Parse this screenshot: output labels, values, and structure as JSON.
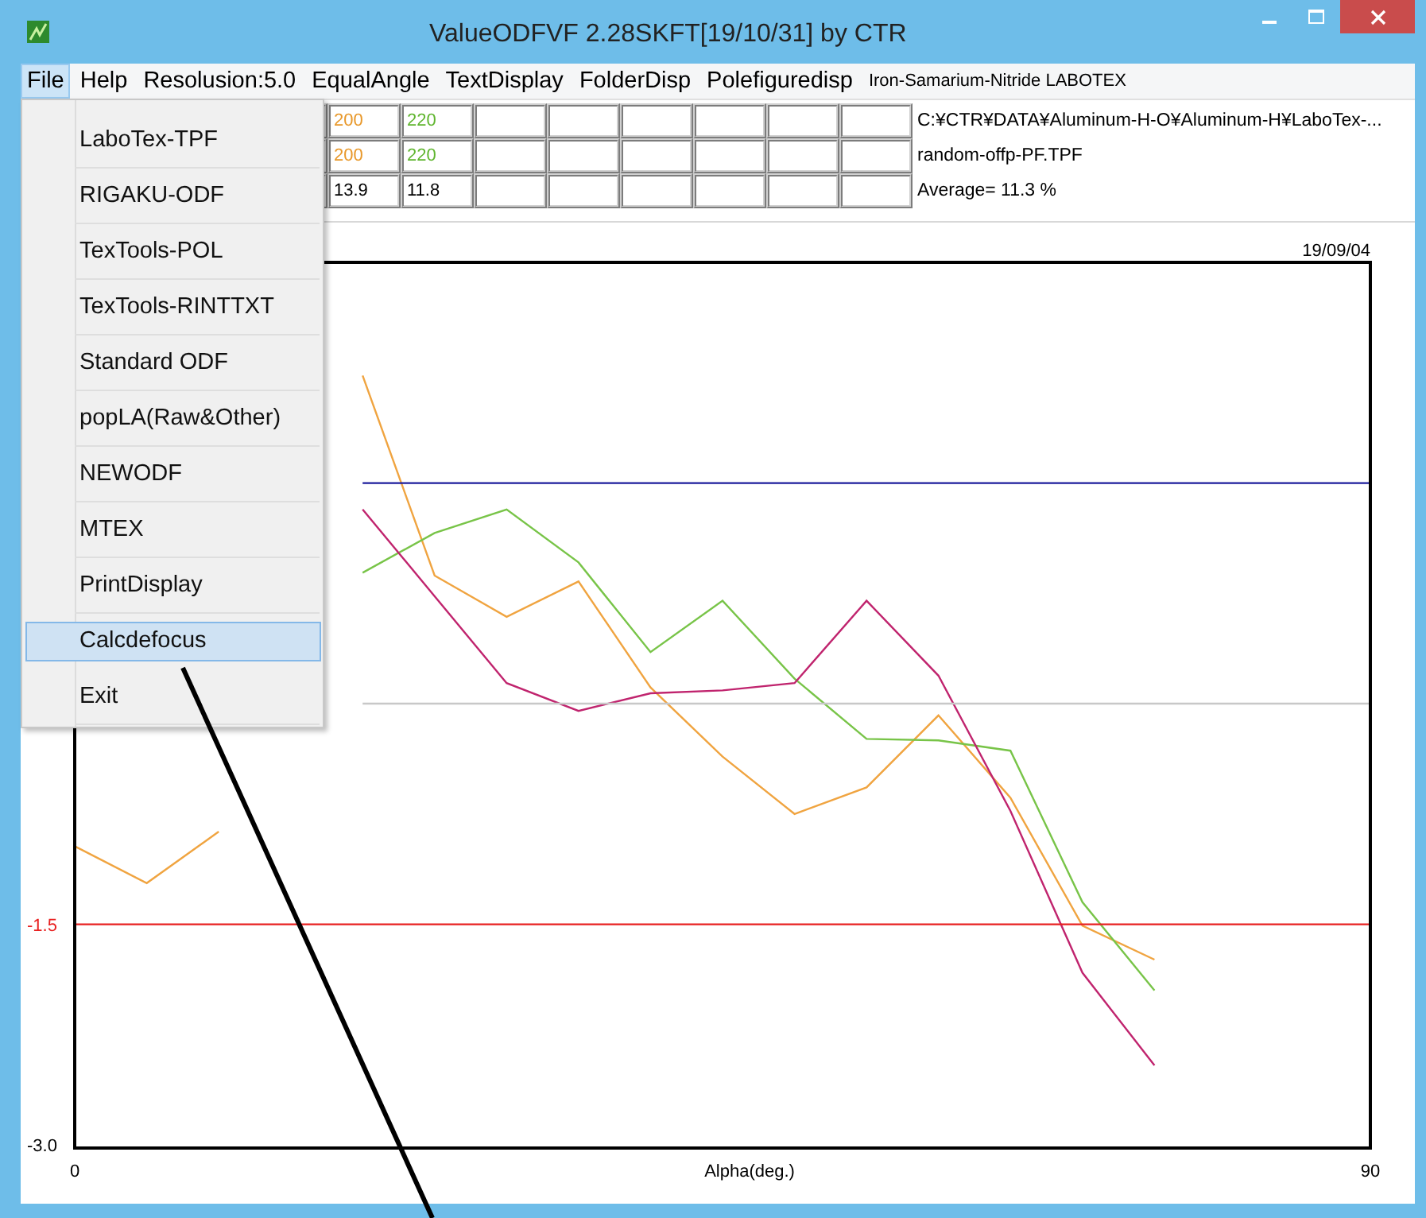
{
  "window": {
    "title": "ValueODFVF 2.28SKFT[19/10/31] by CTR"
  },
  "menu_bar": [
    {
      "label": "File",
      "selected": true,
      "kind": "menu"
    },
    {
      "label": "Help",
      "selected": false,
      "kind": "menu"
    },
    {
      "label": "Resolusion:5.0",
      "selected": false,
      "kind": "menu"
    },
    {
      "label": "EqualAngle",
      "selected": false,
      "kind": "menu"
    },
    {
      "label": "TextDisplay",
      "selected": false,
      "kind": "menu"
    },
    {
      "label": "FolderDisp",
      "selected": false,
      "kind": "menu"
    },
    {
      "label": "Polefiguredisp",
      "selected": false,
      "kind": "menu"
    },
    {
      "label": "Iron-Samarium-Nitride LABOTEX",
      "selected": false,
      "kind": "label"
    }
  ],
  "grid": {
    "rows": [
      {
        "cells": [
          {
            "text": "200",
            "color": "#e8982a"
          },
          {
            "text": "220",
            "color": "#5fb52e"
          },
          {
            "text": ""
          },
          {
            "text": ""
          },
          {
            "text": ""
          },
          {
            "text": ""
          },
          {
            "text": ""
          },
          {
            "text": ""
          }
        ],
        "info": "C:¥CTR¥DATA¥Aluminum-H-O¥Aluminum-H¥LaboTex-..."
      },
      {
        "cells": [
          {
            "text": "200",
            "color": "#e8982a"
          },
          {
            "text": "220",
            "color": "#5fb52e"
          },
          {
            "text": ""
          },
          {
            "text": ""
          },
          {
            "text": ""
          },
          {
            "text": ""
          },
          {
            "text": ""
          },
          {
            "text": ""
          }
        ],
        "info": "random-offp-PF.TPF"
      },
      {
        "cells": [
          {
            "text": "13.9",
            "color": "#000000"
          },
          {
            "text": "11.8",
            "color": "#000000"
          },
          {
            "text": ""
          },
          {
            "text": ""
          },
          {
            "text": ""
          },
          {
            "text": ""
          },
          {
            "text": ""
          },
          {
            "text": ""
          }
        ],
        "info": "Average= 11.3 %"
      }
    ]
  },
  "date": "19/09/04",
  "chart_data": {
    "type": "line",
    "xlabel": "Alpha(deg.)",
    "x": [
      0,
      5,
      10,
      15,
      20,
      25,
      30,
      35,
      40,
      45,
      50,
      55,
      60,
      65,
      70,
      75,
      80,
      85,
      90
    ],
    "xlim": [
      0,
      90
    ],
    "ylim": [
      -3,
      3
    ],
    "xticks": [
      0,
      90
    ],
    "yticks": [
      {
        "value": -1.5,
        "label": "-1.5"
      },
      {
        "value": -3,
        "label": "-3.0"
      }
    ],
    "series": [
      {
        "color": "#f0a440",
        "values": [
          -0.97,
          -1.22,
          -0.87,
          null,
          2.23,
          0.87,
          0.59,
          0.83,
          0.11,
          -0.36,
          -0.75,
          -0.57,
          -0.08,
          -0.64,
          -1.51,
          -1.74,
          null,
          null,
          null
        ]
      },
      {
        "color": "#78c448",
        "values": [
          null,
          null,
          null,
          null,
          0.89,
          1.16,
          1.32,
          0.96,
          0.35,
          0.7,
          0.17,
          -0.24,
          -0.25,
          -0.32,
          -1.35,
          -1.95,
          null,
          null,
          null
        ]
      },
      {
        "color": "#c0246e",
        "values": [
          null,
          null,
          null,
          null,
          1.32,
          0.73,
          0.14,
          -0.05,
          0.07,
          0.09,
          0.14,
          0.7,
          0.19,
          -0.73,
          -1.83,
          -2.46,
          null,
          null,
          null
        ]
      },
      {
        "color": "#1c1c9c",
        "values": [
          null,
          null,
          null,
          null,
          1.5,
          1.5,
          1.5,
          1.5,
          1.5,
          1.5,
          1.5,
          1.5,
          1.5,
          1.5,
          1.5,
          1.5,
          1.5,
          1.5,
          1.5
        ]
      },
      {
        "color": "#c8c8c8",
        "values": [
          null,
          null,
          null,
          null,
          0,
          0,
          0,
          0,
          0,
          0,
          0,
          0,
          0,
          0,
          0,
          0,
          0,
          0,
          0
        ]
      },
      {
        "color": "#e82020",
        "values": [
          -1.5,
          -1.5,
          -1.5,
          -1.5,
          -1.5,
          -1.5,
          -1.5,
          -1.5,
          -1.5,
          -1.5,
          -1.5,
          -1.5,
          -1.5,
          -1.5,
          -1.5,
          -1.5,
          -1.5,
          -1.5,
          -1.5
        ]
      }
    ]
  },
  "open_menu": {
    "items": [
      {
        "label": "LaboTex-TPF",
        "selected": false
      },
      {
        "label": "RIGAKU-ODF",
        "selected": false
      },
      {
        "label": "TexTools-POL",
        "selected": false
      },
      {
        "label": "TexTools-RINTTXT",
        "selected": false
      },
      {
        "label": "Standard ODF",
        "selected": false
      },
      {
        "label": "popLA(Raw&Other)",
        "selected": false
      },
      {
        "label": "NEWODF",
        "selected": false
      },
      {
        "label": "MTEX",
        "selected": false
      },
      {
        "label": "PrintDisplay",
        "selected": false
      },
      {
        "label": "Calcdefocus",
        "selected": true
      },
      {
        "label": "Exit",
        "selected": false
      }
    ]
  }
}
